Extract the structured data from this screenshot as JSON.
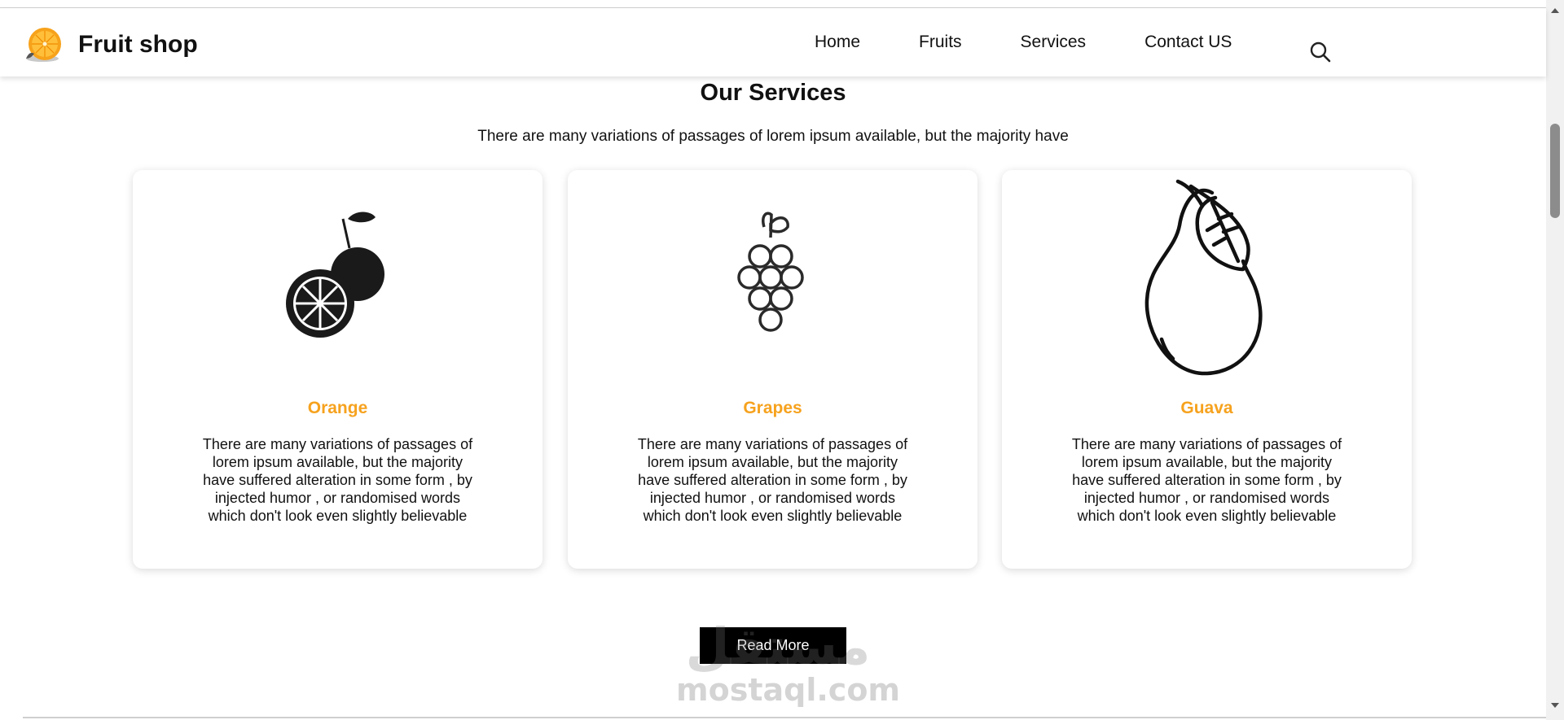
{
  "header": {
    "brand_name": "Fruit shop",
    "nav": [
      {
        "label": "Home"
      },
      {
        "label": "Fruits"
      },
      {
        "label": "Services"
      },
      {
        "label": "Contact US"
      }
    ],
    "search_icon": "search-icon",
    "logo_icon": "orange-slice-icon"
  },
  "services": {
    "title": "Our Services",
    "subtitle": "There are many variations of passages of lorem ipsum available, but the majority have",
    "cards": [
      {
        "icon": "orange-icon",
        "title": "Orange",
        "text": "There are many variations of passages of lorem ipsum available, but the majority have suffered alteration in some form , by injected humor , or randomised words which don't look even slightly believable"
      },
      {
        "icon": "grapes-icon",
        "title": "Grapes",
        "text": "There are many variations of passages of lorem ipsum available, but the majority have suffered alteration in some form , by injected humor , or randomised words which don't look even slightly believable"
      },
      {
        "icon": "pear-icon",
        "title": "Guava",
        "text": "There are many variations of passages of lorem ipsum available, but the majority have suffered alteration in some form , by injected humor , or randomised words which don't look even slightly believable"
      }
    ],
    "read_more_label": "Read More"
  },
  "watermark": {
    "arabic": "مستقل",
    "latin": "mostaql.com"
  },
  "colors": {
    "accent": "#f6a21e",
    "button_bg": "#000000",
    "text": "#111111"
  }
}
